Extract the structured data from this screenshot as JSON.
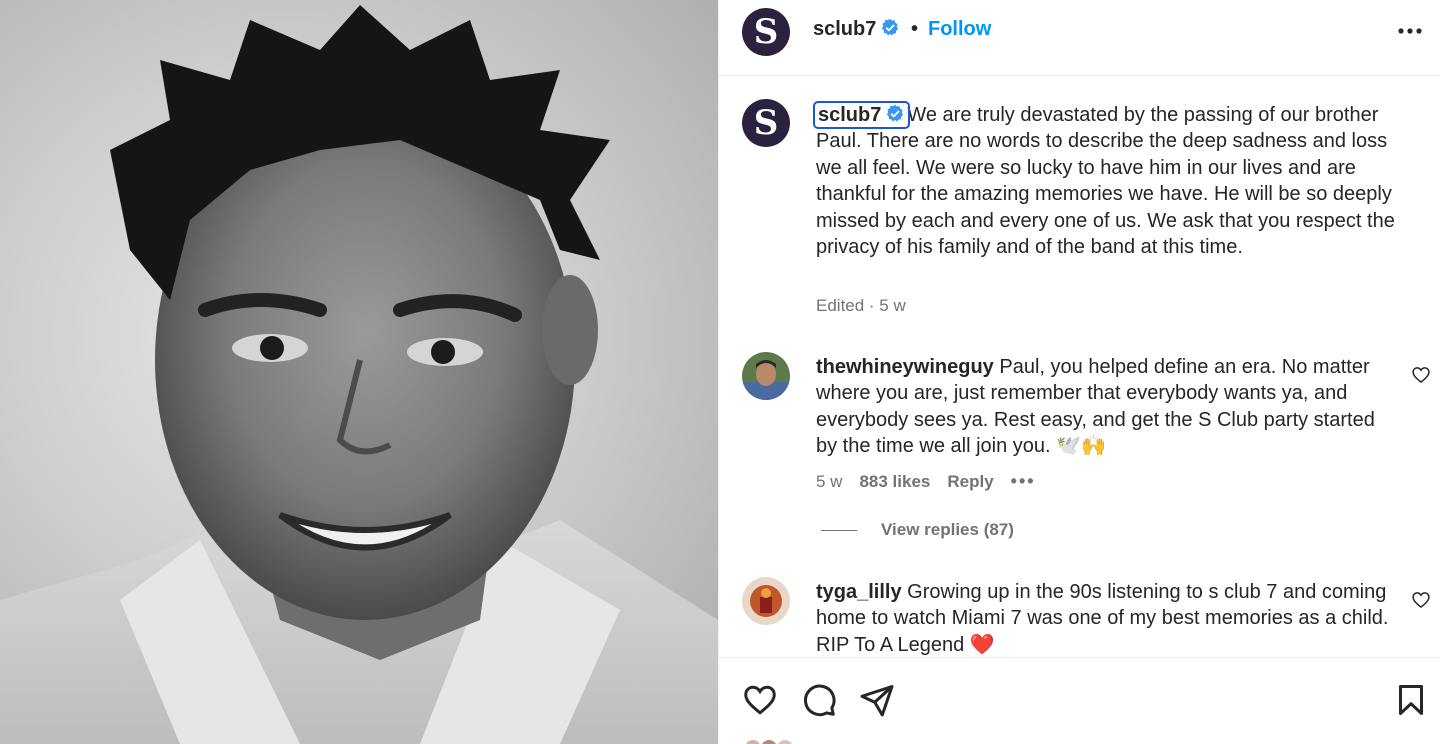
{
  "post": {
    "username": "sclub7",
    "separator": "•",
    "follow_label": "Follow",
    "avatar_letter": "S",
    "caption_text": "We are truly devastated by the passing of our brother Paul. There are no words to describe the deep sadness and loss we all feel. We were so lucky to have him in our lives and are thankful for the amazing memories we have. He will be so deeply missed by each and every one of us. We ask that you respect the privacy of his family and of the band at this time.",
    "caption_meta": "Edited · 5 w"
  },
  "comments": [
    {
      "username": "thewhineywineguy",
      "text": "Paul, you helped define an era. No matter where you are, just remember that everybody wants ya, and everybody sees ya. Rest easy, and get the S Club party started by the time we all join you. 🕊️🙌",
      "age": "5 w",
      "likes": "883 likes",
      "reply_label": "Reply",
      "more_label": "•••",
      "view_replies": "View replies (87)"
    },
    {
      "username": "tyga_lilly",
      "text": "Growing up in the 90s listening to s club 7 and coming home to watch Miami 7 was one of my best memories as a child. RIP To A Legend ❤️"
    }
  ],
  "colors": {
    "accent": "#0095f6",
    "verified": "#3897f0",
    "avatar_bg": "#2b2240",
    "text": "#262626",
    "muted": "#737373"
  },
  "icons": {
    "header_more": "more-horizontal-icon",
    "verified": "verified-badge-icon",
    "like": "heart-icon",
    "comment": "comment-icon",
    "share": "paper-plane-icon",
    "save": "bookmark-icon"
  }
}
